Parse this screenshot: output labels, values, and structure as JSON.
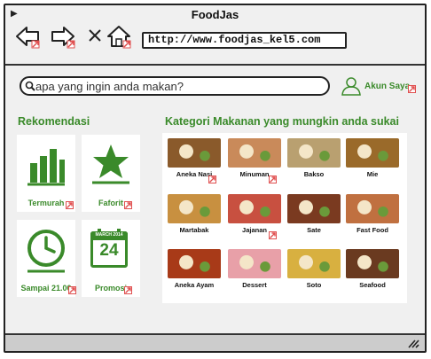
{
  "window": {
    "title": "FoodJas"
  },
  "navigation": {
    "back_icon": "back-arrow-icon",
    "forward_icon": "forward-arrow-icon",
    "close_icon": "close-icon",
    "home_icon": "home-icon"
  },
  "address_bar": {
    "url": "http://www.foodjas_kel5.com"
  },
  "search": {
    "placeholder": "apa yang ingin anda makan?"
  },
  "account": {
    "label": "Akun Saya",
    "icon": "user-icon"
  },
  "rekomendasi": {
    "title": "Rekomendasi",
    "items": [
      {
        "label": "Termurah",
        "icon": "bar-chart-icon"
      },
      {
        "label": "Faforit",
        "icon": "star-icon"
      },
      {
        "label": "Sampai 21.00",
        "icon": "clock-icon"
      },
      {
        "label": "Promosi",
        "icon": "calendar-icon",
        "calendar_header": "MARCH 2014",
        "calendar_day": "24"
      }
    ]
  },
  "kategori": {
    "title": "Kategori Makanan yang mungkin anda sukai",
    "items": [
      {
        "label": "Aneka Nasi",
        "color": "#8a5a2b"
      },
      {
        "label": "Minuman",
        "color": "#c98a5a"
      },
      {
        "label": "Bakso",
        "color": "#b9a070"
      },
      {
        "label": "Mie",
        "color": "#9a6a2a"
      },
      {
        "label": "Martabak",
        "color": "#c89040"
      },
      {
        "label": "Jajanan",
        "color": "#c85040"
      },
      {
        "label": "Sate",
        "color": "#7a3a20"
      },
      {
        "label": "Fast Food",
        "color": "#c07040"
      },
      {
        "label": "Aneka Ayam",
        "color": "#a83a18"
      },
      {
        "label": "Dessert",
        "color": "#e8a0a8"
      },
      {
        "label": "Soto",
        "color": "#d8b040"
      },
      {
        "label": "Seafood",
        "color": "#6a3a20"
      }
    ]
  },
  "colors": {
    "accent": "#3a8a2a",
    "link_marker": "#e05050"
  }
}
